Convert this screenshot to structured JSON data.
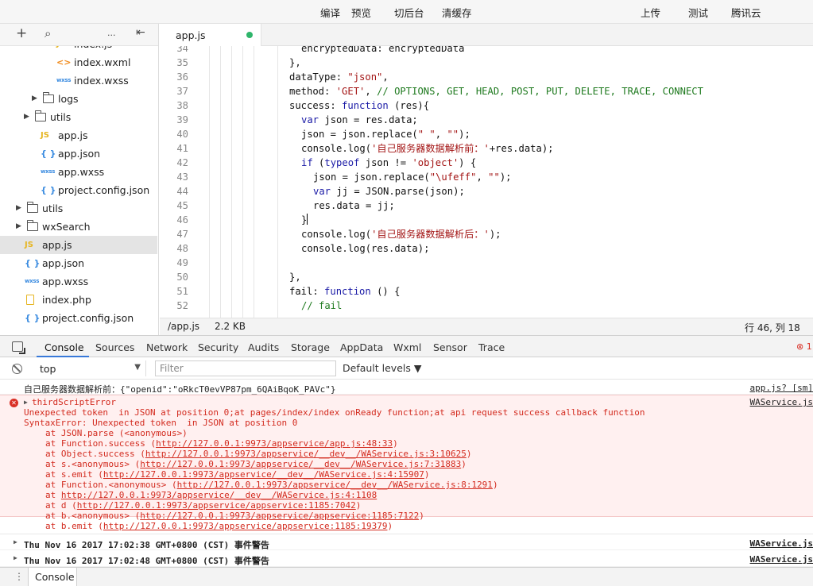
{
  "toolbar": {
    "compile": "编译",
    "preview": "预览",
    "background": "切后台",
    "clear_cache": "清缓存",
    "upload": "上传",
    "test": "测试",
    "tencent_cloud": "腾讯云"
  },
  "sidebar": {
    "tools": {
      "add": "+",
      "search": "⌕",
      "more": "···",
      "collapse": "⇤"
    },
    "items": [
      {
        "label": "index.js",
        "type": "js",
        "indent": 2
      },
      {
        "label": "index.wxml",
        "type": "wxml",
        "indent": 2
      },
      {
        "label": "index.wxss",
        "type": "wxss",
        "indent": 2
      },
      {
        "label": "logs",
        "type": "folder",
        "indent": 1,
        "collapsed": true
      },
      {
        "label": "utils",
        "type": "folder",
        "indent": 0.5,
        "collapsed": true
      },
      {
        "label": "app.js",
        "type": "js",
        "indent": 1
      },
      {
        "label": "app.json",
        "type": "json",
        "indent": 1
      },
      {
        "label": "app.wxss",
        "type": "wxss",
        "indent": 1
      },
      {
        "label": "project.config.json",
        "type": "json",
        "indent": 1
      },
      {
        "label": "utils",
        "type": "folder",
        "indent": 0,
        "collapsed": true
      },
      {
        "label": "wxSearch",
        "type": "folder",
        "indent": 0,
        "collapsed": true
      },
      {
        "label": "app.js",
        "type": "js",
        "indent": 0,
        "selected": true
      },
      {
        "label": "app.json",
        "type": "json",
        "indent": 0
      },
      {
        "label": "app.wxss",
        "type": "wxss",
        "indent": 0
      },
      {
        "label": "index.php",
        "type": "php",
        "indent": 0
      },
      {
        "label": "project.config.json",
        "type": "json",
        "indent": 0
      }
    ]
  },
  "editor": {
    "tab_label": "app.js",
    "lines": [
      {
        "n": "34",
        "html": "encryptedData: encryptedData",
        "indent": 1
      },
      {
        "n": "35",
        "html": "},",
        "indent": 0
      },
      {
        "n": "36",
        "html": "dataType: <span class=\"str\">\"json\"</span>,",
        "indent": 0
      },
      {
        "n": "37",
        "html": "method: <span class=\"str\">'GET'</span>, <span class=\"cm\">// OPTIONS, GET, HEAD, POST, PUT, DELETE, TRACE, CONNECT</span>",
        "indent": 0
      },
      {
        "n": "38",
        "html": "success: <span class=\"kw\">function</span> (res){",
        "indent": 0
      },
      {
        "n": "39",
        "html": "<span class=\"kw\">var</span> json = res.data;",
        "indent": 1
      },
      {
        "n": "40",
        "html": "json = json.replace(<span class=\"str\">\" \"</span>, <span class=\"str\">\"\"</span>);",
        "indent": 1
      },
      {
        "n": "41",
        "html": "console.log(<span class=\"str\">'自己服务器数据解析前：'</span>+res.data);",
        "indent": 1
      },
      {
        "n": "42",
        "html": "<span class=\"kw\">if</span> (<span class=\"kw\">typeof</span> json != <span class=\"str\">'object'</span>) {",
        "indent": 1
      },
      {
        "n": "43",
        "html": "json = json.replace(<span class=\"str\">\"\\ufeff\"</span>, <span class=\"str\">\"\"</span>);",
        "indent": 2
      },
      {
        "n": "44",
        "html": "<span class=\"kw\">var</span> jj = JSON.parse(json);",
        "indent": 2
      },
      {
        "n": "45",
        "html": "res.data = jj;",
        "indent": 2
      },
      {
        "n": "46",
        "html": "}<span class=\"cursor\"></span>",
        "indent": 1
      },
      {
        "n": "47",
        "html": "console.log(<span class=\"str\">'自己服务器数据解析后：'</span>);",
        "indent": 1
      },
      {
        "n": "48",
        "html": "console.log(res.data);",
        "indent": 1
      },
      {
        "n": "49",
        "html": "",
        "indent": 0
      },
      {
        "n": "50",
        "html": "},",
        "indent": 0
      },
      {
        "n": "51",
        "html": "fail: <span class=\"kw\">function</span> () {",
        "indent": 0
      },
      {
        "n": "52",
        "html": "<span class=\"cm\">// fail</span>",
        "indent": 1
      }
    ]
  },
  "status": {
    "path": "/app.js",
    "size": "2.2 KB",
    "position": "行 46, 列 18"
  },
  "devtools": {
    "tabs": [
      "Console",
      "Sources",
      "Network",
      "Security",
      "Audits",
      "Storage",
      "AppData",
      "Wxml",
      "Sensor",
      "Trace"
    ],
    "active_tab": "Console",
    "error_count": "1",
    "context": "top",
    "filter_placeholder": "Filter",
    "levels": "Default levels ▼"
  },
  "console": {
    "log1": {
      "text": "自己服务器数据解析前：{\"openid\":\"oRkcT0evVP87pm_6QAiBqoK_PAVc\"}",
      "source": "app.js? [sm]"
    },
    "error": {
      "title": "thirdScriptError",
      "source": "WAService.js",
      "lines": [
        {
          "pre": "Unexpected token  in JSON at position 0;at pages/index/index onReady function;at api request success callback function",
          "link": "",
          "post": "",
          "indent": 0
        },
        {
          "pre": "SyntaxError: Unexpected token  in JSON at position 0",
          "link": "",
          "post": "",
          "indent": 0
        },
        {
          "pre": "at JSON.parse (<anonymous>)",
          "link": "",
          "post": "",
          "indent": 1
        },
        {
          "pre": "at Function.success (",
          "link": "http://127.0.0.1:9973/appservice/app.js:48:33",
          "post": ")",
          "indent": 1
        },
        {
          "pre": "at Object.success (",
          "link": "http://127.0.0.1:9973/appservice/__dev__/WAService.js:3:10625",
          "post": ")",
          "indent": 1
        },
        {
          "pre": "at s.<anonymous> (",
          "link": "http://127.0.0.1:9973/appservice/__dev__/WAService.js:7:31883",
          "post": ")",
          "indent": 1
        },
        {
          "pre": "at s.emit (",
          "link": "http://127.0.0.1:9973/appservice/__dev__/WAService.js:4:15907",
          "post": ")",
          "indent": 1
        },
        {
          "pre": "at Function.<anonymous> (",
          "link": "http://127.0.0.1:9973/appservice/__dev__/WAService.js:8:1291",
          "post": ")",
          "indent": 1
        },
        {
          "pre": "at ",
          "link": "http://127.0.0.1:9973/appservice/__dev__/WAService.js:4:1108",
          "post": "",
          "indent": 1
        },
        {
          "pre": "at d (",
          "link": "http://127.0.0.1:9973/appservice/appservice:1185:7042",
          "post": ")",
          "indent": 1
        },
        {
          "pre": "at b.<anonymous> (",
          "link": "http://127.0.0.1:9973/appservice/appservice:1185:7122",
          "post": ")",
          "indent": 1
        },
        {
          "pre": "at b.emit (",
          "link": "http://127.0.0.1:9973/appservice/appservice:1185:19379",
          "post": ")",
          "indent": 1
        }
      ]
    },
    "warn1": {
      "text": "Thu Nov 16 2017 17:02:38 GMT+0800 (CST) 事件警告",
      "source": "WAService.js"
    },
    "warn2": {
      "text": "Thu Nov 16 2017 17:02:48 GMT+0800 (CST) 事件警告",
      "source": "WAService.js"
    }
  },
  "drawer": {
    "tab": "Console"
  }
}
